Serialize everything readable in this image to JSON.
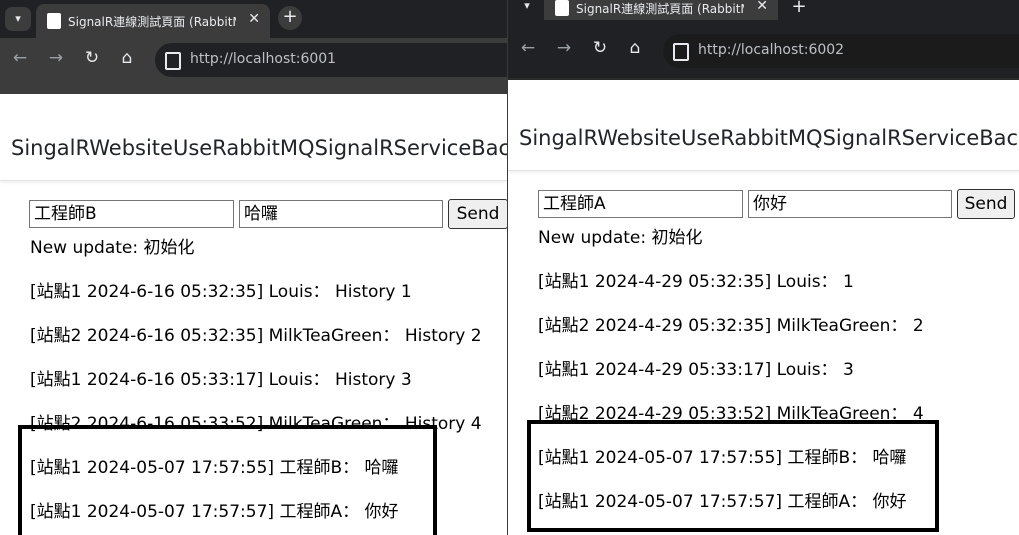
{
  "window1": {
    "tab_title": "SignalR連線測試頁面 (RabbitMQ)",
    "url": "http://localhost:6001",
    "brand": "SingalRWebsiteUseRabbitMQSignalRServiceBackplane",
    "user_value": "工程師B",
    "message_value": "哈囉",
    "send_label": "Send",
    "status": "New update: 初始化",
    "messages": [
      "[站點1 2024-6-16 05:32:35] Louis： History 1",
      "[站點2 2024-6-16 05:32:35] MilkTeaGreen： History 2",
      "[站點1 2024-6-16 05:33:17] Louis： History 3",
      "[站點2 2024-6-16 05:33:52] MilkTeaGreen： History 4",
      "[站點1 2024-05-07 17:57:55] 工程師B： 哈囉",
      "[站點1 2024-05-07 17:57:57] 工程師A： 你好"
    ]
  },
  "window2": {
    "tab_title": "SignalR連線測試頁面 (RabbitMQ)",
    "url": "http://localhost:6002",
    "brand": "SingalRWebsiteUseRabbitMQSignalRServiceBackplane",
    "user_value": "工程師A",
    "message_value": "你好",
    "send_label": "Send",
    "status": "New update: 初始化",
    "messages": [
      "[站點1 2024-4-29 05:32:35] Louis： 1",
      "[站點2 2024-4-29 05:32:35] MilkTeaGreen： 2",
      "[站點1 2024-4-29 05:33:17] Louis： 3",
      "[站點2 2024-4-29 05:33:52] MilkTeaGreen： 4",
      "[站點1 2024-05-07 17:57:55] 工程師B： 哈囉",
      "[站點1 2024-05-07 17:57:57] 工程師A： 你好"
    ]
  },
  "icons": {
    "tab_list": "▾",
    "close": "✕",
    "new_tab": "+",
    "back": "←",
    "forward": "→",
    "reload": "↻",
    "home": "⌂"
  },
  "colors": {
    "browser_frame": "#202124",
    "toolbar": "#3c3c3c",
    "highlight_frame": "#000000"
  }
}
